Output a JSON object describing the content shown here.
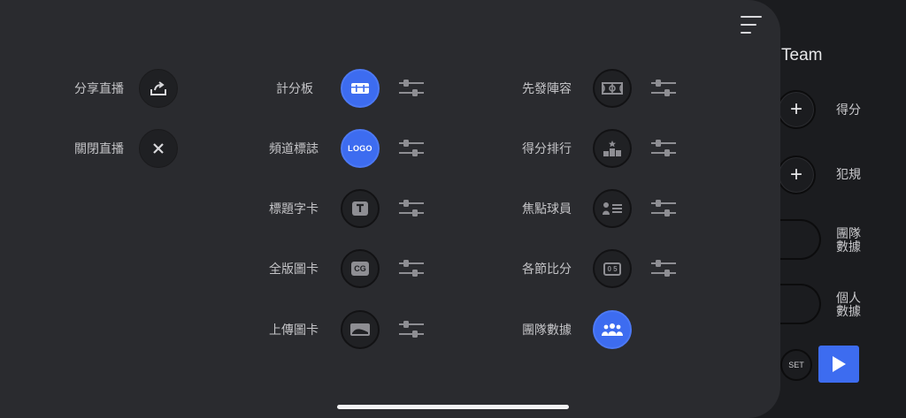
{
  "right_panel": {
    "team_title": "Team",
    "rows": [
      {
        "label": "得分",
        "icon": "plus-icon"
      },
      {
        "label": "犯規",
        "icon": "plus-icon"
      },
      {
        "label_lines": [
          "團隊",
          "數據"
        ]
      },
      {
        "label_lines": [
          "個人",
          "數據"
        ]
      }
    ],
    "set_label": "SET"
  },
  "overlay": {
    "left_column": [
      {
        "label": "分享直播",
        "icon": "share-icon"
      },
      {
        "label": "關閉直播",
        "icon": "close-icon"
      }
    ],
    "middle_column": [
      {
        "label": "計分板",
        "icon": "scoreboard-icon",
        "active": true
      },
      {
        "label": "頻道標誌",
        "icon_text": "LOGO",
        "active": true
      },
      {
        "label": "標題字卡",
        "icon": "title-card-icon"
      },
      {
        "label": "全版圖卡",
        "icon_text": "CG"
      },
      {
        "label": "上傳圖卡",
        "icon": "image-icon"
      }
    ],
    "right_column": [
      {
        "label": "先發陣容",
        "icon": "court-icon"
      },
      {
        "label": "得分排行",
        "icon": "podium-icon"
      },
      {
        "label": "焦點球員",
        "icon": "player-card-icon"
      },
      {
        "label": "各節比分",
        "icon_text": "0 5",
        "icon": "quarter-score-icon"
      },
      {
        "label": "團隊數據",
        "icon": "team-icon",
        "active": true
      }
    ]
  },
  "colors": {
    "accent": "#3d6cf0",
    "panel": "#2a2b2f",
    "background": "#1b1c1f"
  }
}
